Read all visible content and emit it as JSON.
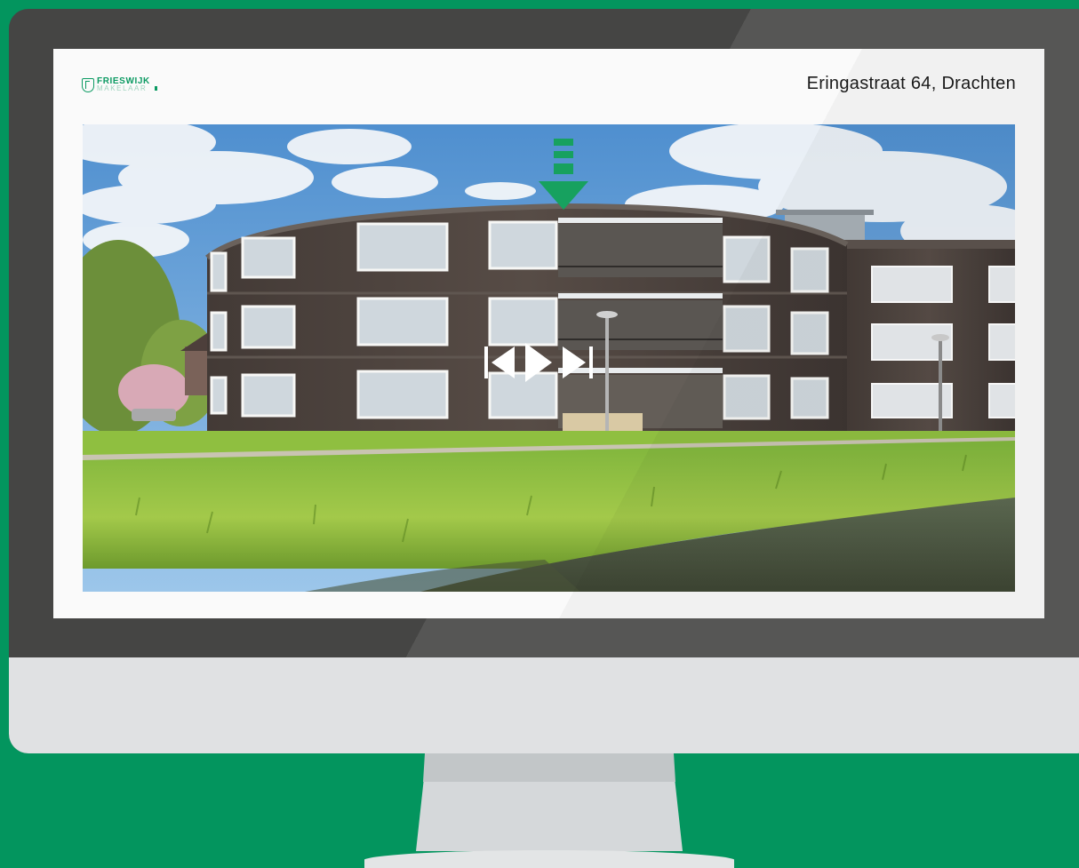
{
  "logo": {
    "brand": "FRIESWIJK",
    "sub": "MAKELAAR"
  },
  "listing": {
    "address": "Eringastraat 64, Drachten"
  },
  "icons": {
    "marker": "down-arrow-icon",
    "prev": "skip-previous-icon",
    "play": "play-icon",
    "next": "skip-next-icon"
  },
  "colors": {
    "background": "#03955e",
    "accent": "#17a15f",
    "bezel": "#454544",
    "chin": "#e0e1e3"
  }
}
